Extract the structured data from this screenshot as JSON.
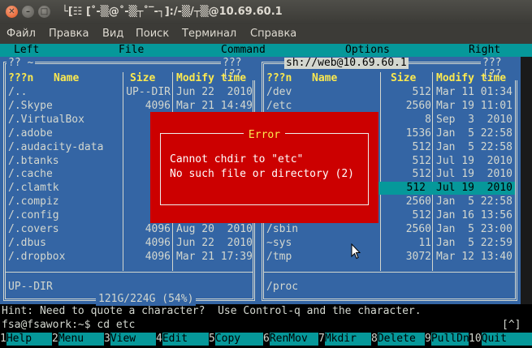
{
  "window": {
    "title": "└[☷ [˚-▒@˚-▒┬˚‾-┐]:/-▒/┬▒@10.69.60.1",
    "close_glyph": "✕",
    "min_glyph": "–",
    "max_glyph": "□"
  },
  "menubar": {
    "items": [
      "Файл",
      "Правка",
      "Вид",
      "Поиск",
      "Терминал",
      "Справка"
    ]
  },
  "mc_menu": {
    "items": [
      "Left",
      "File",
      "Command",
      "Options",
      "Right"
    ]
  },
  "left_panel": {
    "path_left": "?? ~",
    "path_right": "???[??",
    "headers": {
      "name_prefix": "???n",
      "name": "Name",
      "size": "Size",
      "mtime": "Modify time"
    },
    "rows": [
      {
        "name": "/..",
        "size": "UP--DIR",
        "mtime": "Jun 22  2010"
      },
      {
        "name": "/.Skype",
        "size": "4096",
        "mtime": "Mar 21 14:49"
      },
      {
        "name": "/.VirtualBox",
        "size": "4",
        "mtime": ""
      },
      {
        "name": "/.adobe",
        "size": "4",
        "mtime": ""
      },
      {
        "name": "/.audacity-data",
        "size": "4",
        "mtime": ""
      },
      {
        "name": "/.btanks",
        "size": "4",
        "mtime": ""
      },
      {
        "name": "/.cache",
        "size": "4",
        "mtime": ""
      },
      {
        "name": "/.clamtk",
        "size": "4",
        "mtime": ""
      },
      {
        "name": "/.compiz",
        "size": "4",
        "mtime": ""
      },
      {
        "name": "/.config",
        "size": "4",
        "mtime": ""
      },
      {
        "name": "/.covers",
        "size": "4096",
        "mtime": "Aug 20  2010"
      },
      {
        "name": "/.dbus",
        "size": "4096",
        "mtime": "Jun 22  2010"
      },
      {
        "name": "/.dropbox",
        "size": "4096",
        "mtime": "Mar 21 17:39"
      }
    ],
    "status": "UP--DIR",
    "disk": "121G/224G (54%)"
  },
  "right_panel": {
    "path": "sh://web@10.69.60.1",
    "path_right": "???[??",
    "headers": {
      "name_prefix": "???n",
      "name": "Name",
      "size": "Size",
      "mtime": "Modify time"
    },
    "rows": [
      {
        "name": "/dev",
        "size": "512",
        "mtime": "Mar 11 01:34"
      },
      {
        "name": "/etc",
        "size": "2560",
        "mtime": "Mar 19 11:01"
      },
      {
        "name": "",
        "size": "8",
        "mtime": "Sep  3  2010"
      },
      {
        "name": "",
        "size": "1536",
        "mtime": "Jan  5 22:58"
      },
      {
        "name": "",
        "size": "512",
        "mtime": "Jan  5 22:58"
      },
      {
        "name": "",
        "size": "512",
        "mtime": "Jul 19  2010"
      },
      {
        "name": "",
        "size": "512",
        "mtime": "Jul 19  2010"
      },
      {
        "name": "",
        "size": "512",
        "mtime": "Jul 19  2010"
      },
      {
        "name": "",
        "size": "2560",
        "mtime": "Jan  5 22:58"
      },
      {
        "name": "",
        "size": "512",
        "mtime": "Jan 16 13:56"
      },
      {
        "name": "/sbin",
        "size": "2560",
        "mtime": "Jan  5 23:00"
      },
      {
        "name": "~sys",
        "size": "11",
        "mtime": "Jan  5 22:59"
      },
      {
        "name": "/tmp",
        "size": "3072",
        "mtime": "Mar 12 13:40"
      }
    ],
    "status": "/proc"
  },
  "dialog": {
    "title": "Error",
    "line1": "Cannot chdir to \"etc\"",
    "line2": "No such file or directory (2)"
  },
  "hint": "Hint: Need to quote a character?  Use Control-q and the character.",
  "command_line": "fsa@fsawork:~$ cd etc",
  "command_button": "[^]",
  "fkeys": [
    {
      "n": "1",
      "label": "Help"
    },
    {
      "n": "2",
      "label": "Menu"
    },
    {
      "n": "3",
      "label": "View"
    },
    {
      "n": "4",
      "label": "Edit"
    },
    {
      "n": "5",
      "label": "Copy"
    },
    {
      "n": "6",
      "label": "RenMov"
    },
    {
      "n": "7",
      "label": "Mkdir"
    },
    {
      "n": "8",
      "label": "Delete"
    },
    {
      "n": "9",
      "label": "PullDn"
    },
    {
      "n": "10",
      "label": "Quit"
    }
  ]
}
